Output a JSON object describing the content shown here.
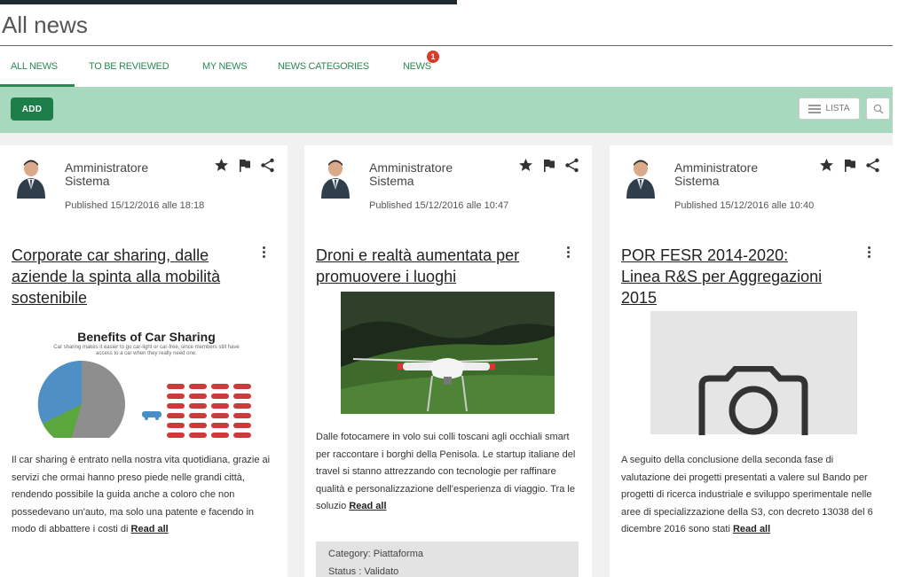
{
  "page": {
    "title": "All news"
  },
  "tabs": [
    {
      "label": "ALL NEWS",
      "active": true
    },
    {
      "label": "TO BE REVIEWED"
    },
    {
      "label": "MY NEWS"
    },
    {
      "label": "NEWS CATEGORIES"
    },
    {
      "label": "NEWS",
      "badge": "1"
    }
  ],
  "toolbar": {
    "add_label": "ADD",
    "lista_label": "LISTA",
    "search_icon": "search-icon"
  },
  "colors": {
    "accent": "#2a8a55",
    "toolbar_bg": "#a8d9bf",
    "add_button": "#1e7e4a",
    "badge": "#d93a2b"
  },
  "icons": {
    "star": "star-icon",
    "flag": "flag-icon",
    "share": "share-icon",
    "more": "kebab-icon",
    "camera": "camera-icon"
  },
  "cards": [
    {
      "author": "Amministratore Sistema",
      "published": "Published 15/12/2016 alle 18:18",
      "title": "Corporate car sharing, dalle aziende la spinta alla mobilità sostenibile",
      "infographic_title": "Benefits of Car Sharing",
      "infographic_sub": "Car sharing makes it easier to go car-light or car-free, since members still have access to a car when they really need one.",
      "description": "Il car sharing è entrato nella nostra vita quotidiana, grazie ai servizi che ormai hanno preso piede nelle grandi città, rendendo possibile la guida anche a coloro che non possedevano un'auto, ma solo una patente e facendo in modo di abbattere i costi di",
      "read_all": "Read all"
    },
    {
      "author": "Amministratore Sistema",
      "published": "Published 15/12/2016 alle 10:47",
      "title": "Droni e realtà aumentata per promuovere i luoghi",
      "description": "Dalle fotocamere in volo sui colli toscani agli occhiali smart per raccontare i borghi della Penisola. Le startup italiane del travel si stanno attrezzando con tecnologie per raffinare qualità e personalizzazione dell'esperienza di viaggio. Tra le soluzio",
      "read_all": "Read all",
      "category": "Category: Piattaforma",
      "status": "Status : Validato"
    },
    {
      "author": "Amministratore Sistema",
      "published": "Published 15/12/2016 alle 10:40",
      "title": "POR FESR 2014-2020: Linea R&S per Aggregazioni 2015",
      "description": "A seguito della conclusione della seconda fase di valutazione dei progetti presentati a valere sul Bando per progetti di ricerca industriale e sviluppo sperimentale nelle aree di specializzazione della S3, con decreto 13038 del 6 dicembre 2016 sono stati",
      "read_all": "Read all"
    }
  ]
}
